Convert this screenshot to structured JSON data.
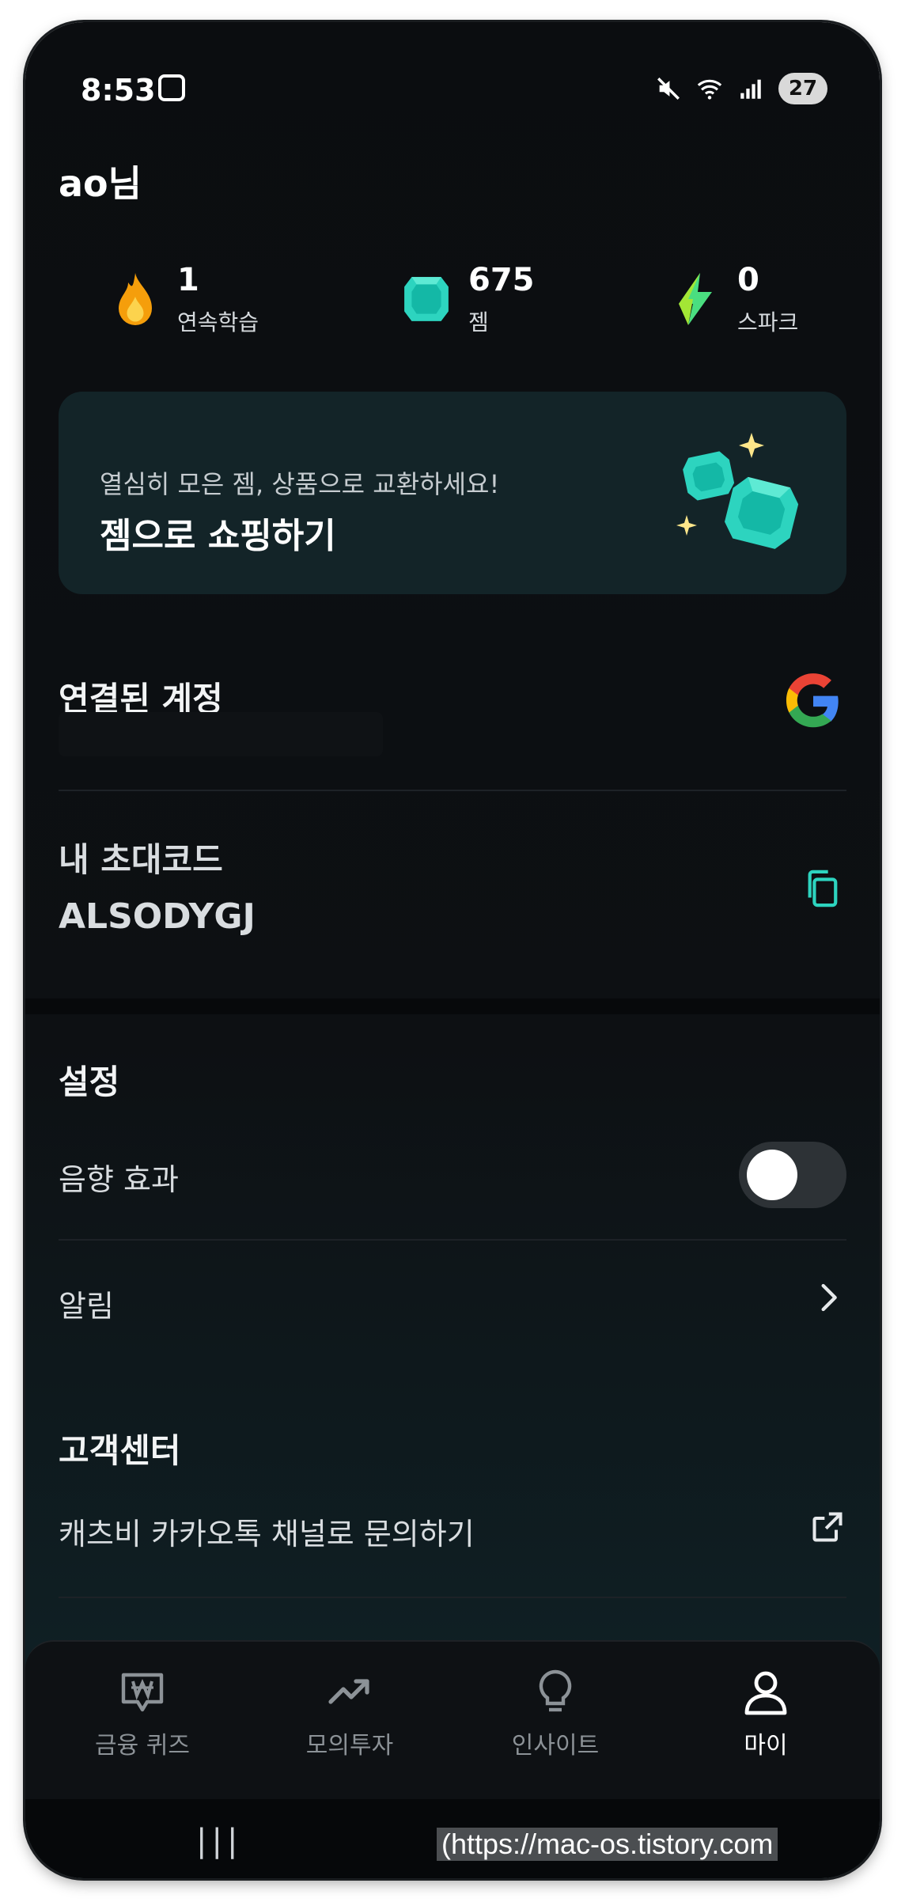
{
  "status_bar": {
    "time": "8:53",
    "battery": "27"
  },
  "user": {
    "greeting": "ao님"
  },
  "stats": [
    {
      "value": "1",
      "label": "연속학습",
      "icon": "fire-icon"
    },
    {
      "value": "675",
      "label": "젬",
      "icon": "gem-icon"
    },
    {
      "value": "0",
      "label": "스파크",
      "icon": "spark-icon"
    }
  ],
  "promo": {
    "subtitle": "열심히 모은 젬, 상품으로 교환하세요!",
    "title": "젬으로 쇼핑하기"
  },
  "linked_account": {
    "title": "연결된 계정",
    "provider": "google"
  },
  "invite": {
    "label": "내 초대코드",
    "code": "ALSODYGJ"
  },
  "settings": {
    "title": "설정",
    "sound_label": "음향 효과",
    "sound_enabled": false,
    "notification_label": "알림"
  },
  "support": {
    "title": "고객센터",
    "kakao_label": "캐츠비 카카오톡 채널로 문의하기"
  },
  "bottom_nav": [
    {
      "label": "금융 퀴즈",
      "icon": "won-chat-icon",
      "active": false
    },
    {
      "label": "모의투자",
      "icon": "trend-up-icon",
      "active": false
    },
    {
      "label": "인사이트",
      "icon": "lightbulb-icon",
      "active": false
    },
    {
      "label": "마이",
      "icon": "person-icon",
      "active": true
    }
  ],
  "system_nav": {
    "recents": "|||",
    "watermark": "(https://mac-os.tistory.com"
  },
  "colors": {
    "background": "#0b0d10",
    "card": "#132428",
    "accent": "#2dd4bf",
    "toggle_off": "#2d3236"
  }
}
